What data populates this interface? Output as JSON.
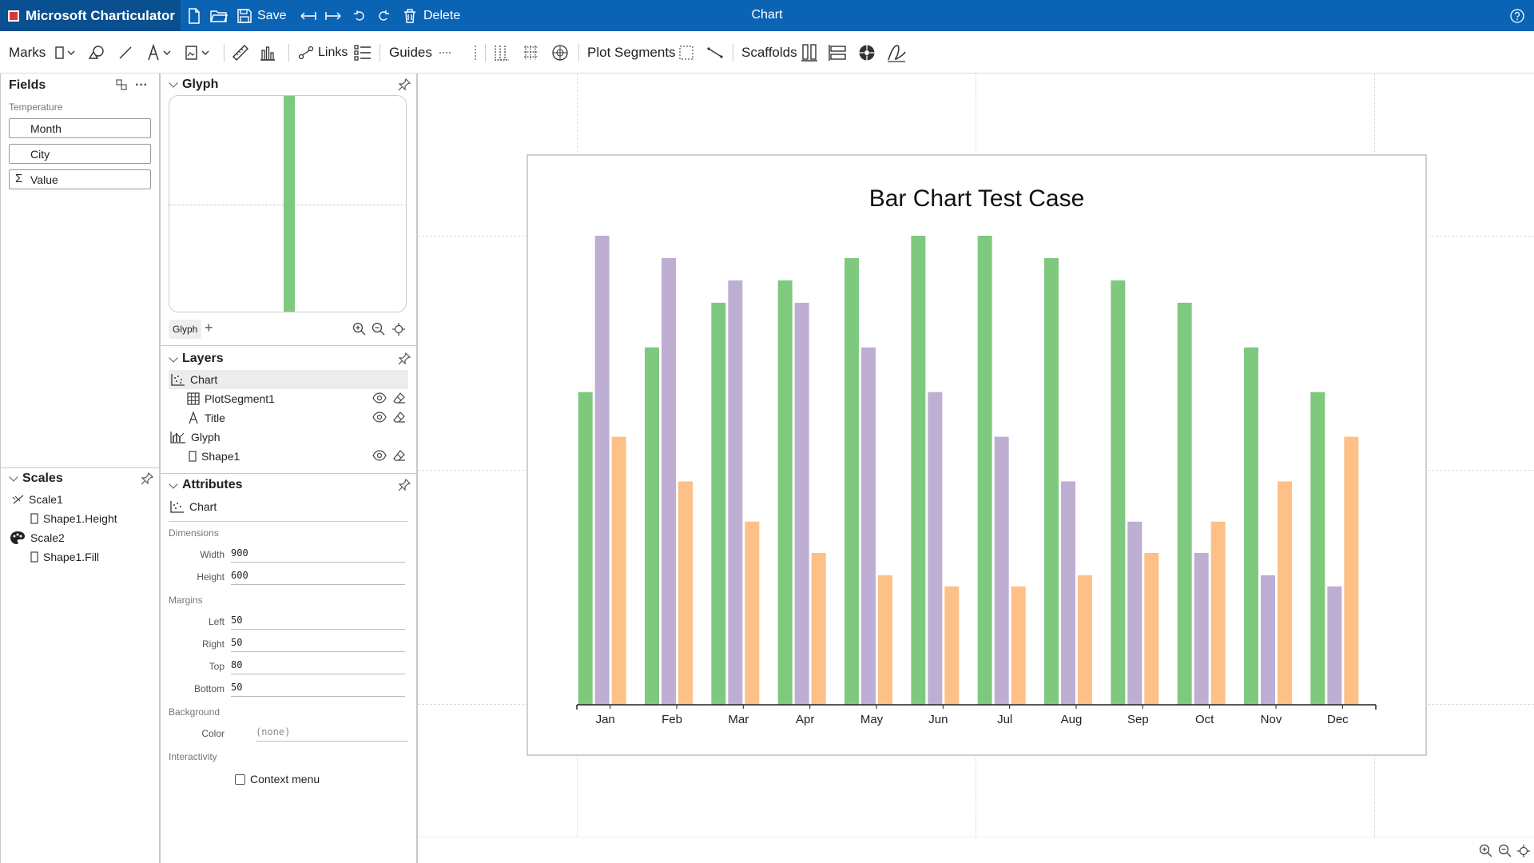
{
  "app": {
    "name": "Microsoft Charticulator",
    "document_title": "Chart",
    "save_label": "Save",
    "delete_label": "Delete"
  },
  "toolbar": {
    "marks_label": "Marks",
    "links_label": "Links",
    "guides_label": "Guides",
    "plot_segments_label": "Plot Segments",
    "scaffolds_label": "Scaffolds"
  },
  "fields": {
    "title": "Fields",
    "table_name": "Temperature",
    "columns": [
      "Month",
      "City",
      "Value"
    ]
  },
  "scales": {
    "title": "Scales",
    "items": [
      {
        "name": "Scale1",
        "binding": "Shape1.Height"
      },
      {
        "name": "Scale2",
        "binding": "Shape1.Fill"
      }
    ]
  },
  "glyph": {
    "title": "Glyph",
    "tab_label": "Glyph",
    "bar_color": "#7fc97f"
  },
  "layers": {
    "title": "Layers",
    "items": [
      "Chart",
      "PlotSegment1",
      "Title",
      "Glyph",
      "Shape1"
    ]
  },
  "attributes": {
    "title": "Attributes",
    "object": "Chart",
    "dimensions_label": "Dimensions",
    "width_label": "Width",
    "width": "900",
    "height_label": "Height",
    "height": "600",
    "margins_label": "Margins",
    "left_label": "Left",
    "left": "50",
    "right_label": "Right",
    "right": "50",
    "top_label": "Top",
    "top": "80",
    "bottom_label": "Bottom",
    "bottom": "50",
    "background_label": "Background",
    "color_label": "Color",
    "color": "(none)",
    "interactivity_label": "Interactivity",
    "context_menu_label": "Context menu",
    "context_menu_checked": false
  },
  "colors": {
    "accent": "#0b63b3",
    "series": [
      "#7fc97f",
      "#beaed4",
      "#fdc086"
    ]
  },
  "chart_data": {
    "type": "bar",
    "title": "Bar Chart Test Case",
    "categories": [
      "Jan",
      "Feb",
      "Mar",
      "Apr",
      "May",
      "Jun",
      "Jul",
      "Aug",
      "Sep",
      "Oct",
      "Nov",
      "Dec"
    ],
    "series": [
      {
        "color": "#7fc97f",
        "values": [
          14,
          16,
          18,
          19,
          20,
          21,
          21,
          20,
          19,
          18,
          16,
          14
        ]
      },
      {
        "color": "#beaed4",
        "values": [
          21,
          20,
          19,
          18,
          16,
          14,
          12,
          10,
          8.2,
          6.8,
          5.8,
          5.3
        ]
      },
      {
        "color": "#fdc086",
        "values": [
          12,
          10,
          8.2,
          6.8,
          5.8,
          5.3,
          5.3,
          5.8,
          6.8,
          8.2,
          10,
          12
        ]
      }
    ],
    "ylim": [
      0,
      21
    ],
    "grid": false,
    "legend": "none"
  }
}
